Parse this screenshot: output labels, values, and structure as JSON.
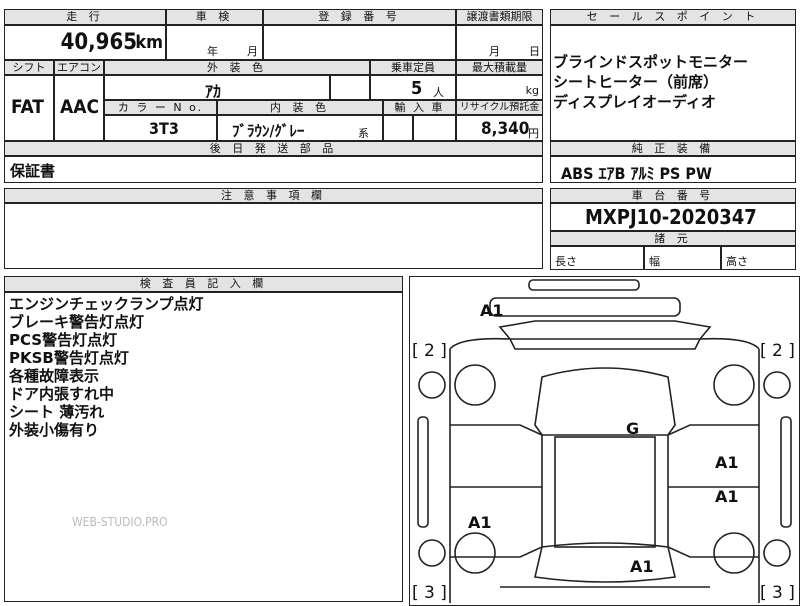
{
  "top": {
    "mileage_header": "走 行",
    "mileage_value": "40,965",
    "mileage_unit": "km",
    "inspection_header": "車 検",
    "inspection_year": "年",
    "inspection_month": "月",
    "registration_header": "登 録 番 号",
    "transfer_header": "譲渡書類期限",
    "transfer_month": "月",
    "transfer_day": "日"
  },
  "row2": {
    "shift_header": "シフト",
    "aircon_header": "エアコン",
    "exterior_color_header": "外 装 色",
    "capacity_header": "乗車定員",
    "max_load_header": "最大積載量",
    "shift_value": "FAT",
    "aircon_value": "AAC",
    "exterior_color_value": "ｱｶ",
    "capacity_value": "5",
    "capacity_unit": "人",
    "load_unit": "kg"
  },
  "row3": {
    "color_no_header": "カ ラ ー N o.",
    "interior_color_header": "内 装 色",
    "import_header": "輸 入 車",
    "recycle_header": "リサイクル預託金",
    "color_no_value": "3T3",
    "interior_color_value": "ﾌﾞﾗｳﾝ/ｸﾞﾚｰ",
    "interior_suffix": "系",
    "recycle_value": "8,340",
    "recycle_unit": "円"
  },
  "later_parts": {
    "header": "後 日 発 送 部 品",
    "value": "保証書"
  },
  "notes": {
    "header": "注 意 事 項 欄"
  },
  "sales_points": {
    "header": "セ ー ル ス ポ イ ン ト",
    "items": [
      "ブラインドスポットモニター",
      "シートヒーター（前席）",
      "ディスプレイオーディオ"
    ]
  },
  "equipment": {
    "header": "純 正 装 備",
    "value": "ABS ｴｱB ｱﾙﾐ PS PW"
  },
  "chassis": {
    "header": "車 台 番 号",
    "value": "MXPJ10-2020347"
  },
  "dimensions": {
    "header": "諸 元",
    "length": "長さ",
    "width": "幅",
    "height": "高さ"
  },
  "inspector": {
    "header": "検 査 員 記 入 欄",
    "lines": [
      "エンジンチェックランプ点灯",
      "ブレーキ警告灯点灯",
      "PCS警告灯点灯",
      "PKSB警告灯点灯",
      "各種故障表示",
      "ドア内張すれ中",
      "シート 薄汚れ",
      "外装小傷有り"
    ],
    "watermark": "WEB-STUDIO.PRO"
  },
  "diagram": {
    "marks": [
      "A1",
      "G",
      "A1",
      "A1",
      "A1",
      "A1"
    ],
    "brackets": [
      "[ 2 ]",
      "[ 2 ]",
      "[ 3 ]",
      "[ 3 ]"
    ]
  }
}
